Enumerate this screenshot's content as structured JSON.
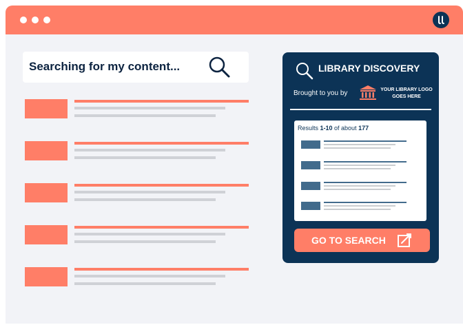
{
  "window": {
    "controls": [
      "close",
      "minimize",
      "maximize"
    ],
    "brand_logo_text": "ɩɩ",
    "colors": {
      "titlebar": "#ff7e67",
      "panel": "#0c3356",
      "accent": "#ff7e67"
    }
  },
  "search": {
    "query": "Searching for my content...",
    "icon": "search-icon"
  },
  "results": [
    {
      "kind": "result-placeholder"
    },
    {
      "kind": "result-placeholder"
    },
    {
      "kind": "result-placeholder"
    },
    {
      "kind": "result-placeholder"
    },
    {
      "kind": "result-placeholder"
    }
  ],
  "panel": {
    "title": "LIBRARY DISCOVERY",
    "brought_by": "Brought to you by",
    "library_logo_text": "YOUR LIBRARY LOGO GOES HERE",
    "library_icon": "library-building-icon",
    "results_summary": {
      "prefix": "Results ",
      "range": "1-10",
      "middle": " of about ",
      "total": "177"
    },
    "mini_results_count_shown": 4,
    "button_label": "GO TO SEARCH",
    "button_icon": "external-link-icon"
  }
}
